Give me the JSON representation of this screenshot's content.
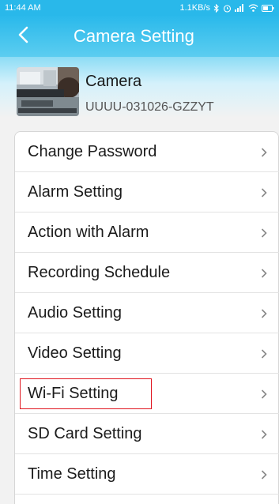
{
  "status_bar": {
    "time": "11:44 AM",
    "network_speed": "1.1KB/s",
    "icons": [
      "bluetooth-icon",
      "alarm-icon",
      "signal-icon",
      "wifi-icon",
      "battery-icon"
    ]
  },
  "header": {
    "title": "Camera Setting",
    "back_icon": "chevron-left-icon"
  },
  "camera": {
    "name": "Camera",
    "uid": "UUUU-031026-GZZYT"
  },
  "menu": {
    "items": [
      {
        "label": "Change Password"
      },
      {
        "label": "Alarm Setting"
      },
      {
        "label": "Action with Alarm"
      },
      {
        "label": "Recording Schedule"
      },
      {
        "label": "Audio Setting"
      },
      {
        "label": "Video Setting"
      },
      {
        "label": "Wi-Fi Setting",
        "highlighted": true
      },
      {
        "label": "SD Card Setting"
      },
      {
        "label": "Time Setting"
      }
    ],
    "chevron_icon": "chevron-right-icon"
  },
  "colors": {
    "header": "#29b8ea",
    "highlight": "#e0141e",
    "text": "#1b1b1b",
    "subtext": "#555555"
  }
}
